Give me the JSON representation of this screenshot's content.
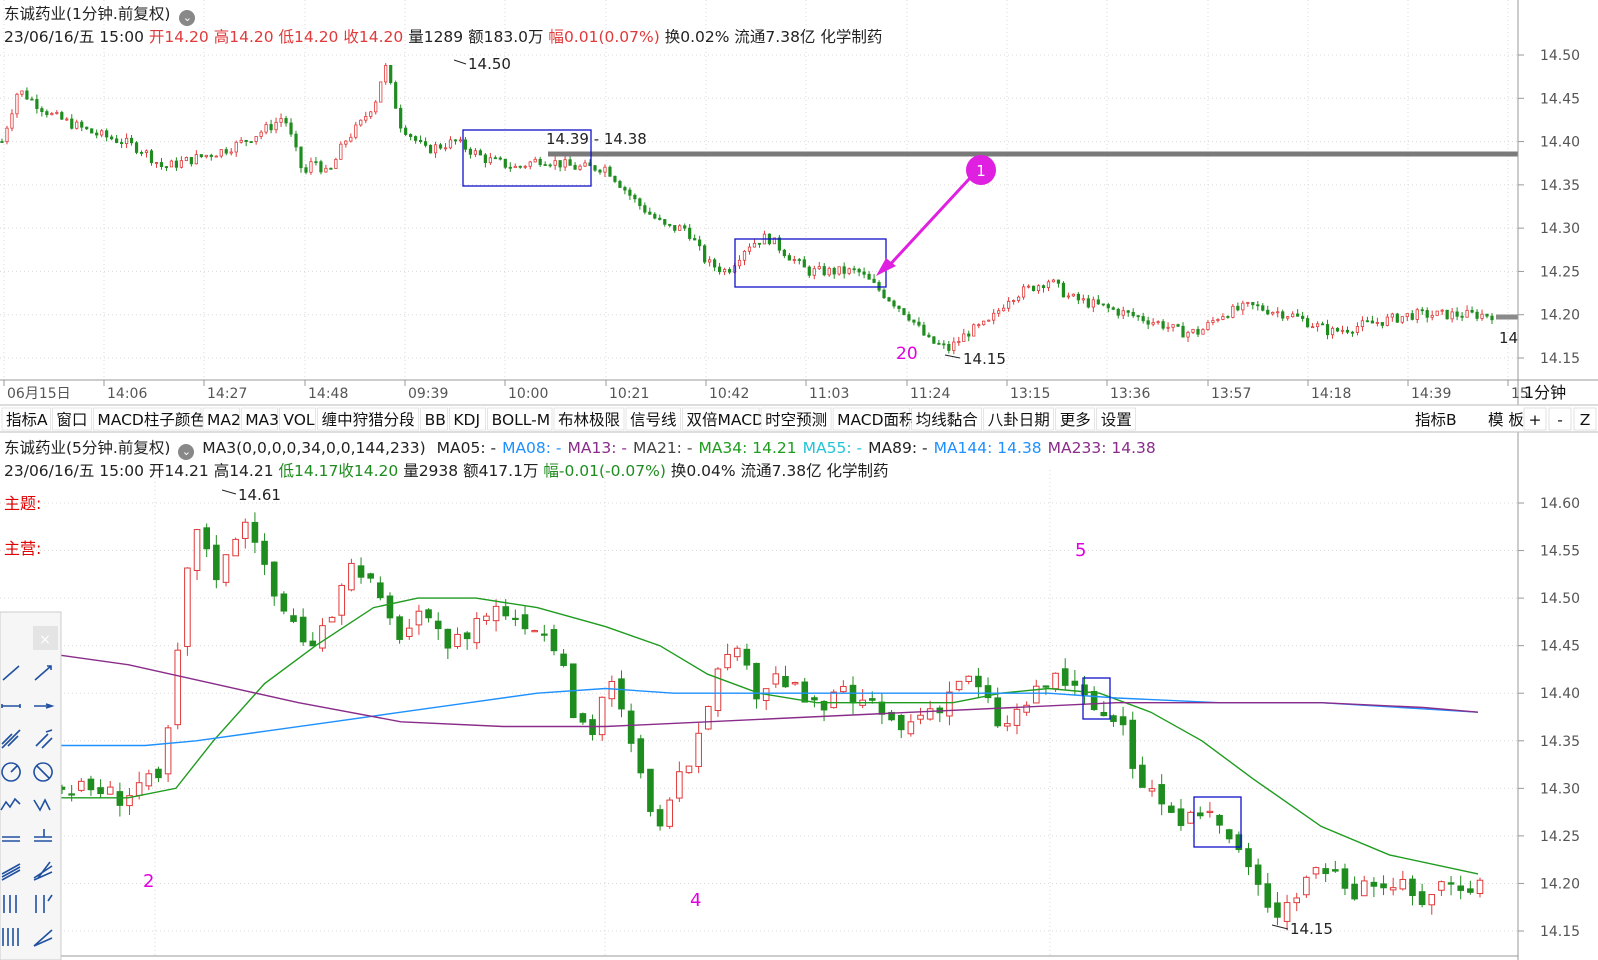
{
  "colors": {
    "up": "#e03a3a",
    "down": "#1f8c1f",
    "grid": "#d9d9d9",
    "ma34": "#1f9c1f",
    "ma144": "#1e90ff",
    "ma233": "#8a2c8a",
    "label": "#e000e0",
    "box": "#1010c8",
    "hline": "#7a7a7a"
  },
  "top": {
    "title": "东诚药业(1分钟.前复权)",
    "info": {
      "datetime": "23/06/16/五 15:00",
      "open_lbl": "开",
      "open": "14.20",
      "high_lbl": "高",
      "high": "14.20",
      "low_lbl": "低",
      "low": "14.20",
      "close_lbl": "收",
      "close": "14.20",
      "vol_lbl": "量",
      "vol": "1289",
      "amt_lbl": "额",
      "amt": "183.0万",
      "chg_lbl": "幅",
      "chg": "0.01(0.07%)",
      "turn": "换0.02%",
      "float": "流通7.38亿",
      "sector": "化学制药"
    },
    "period_btn": "1分钟",
    "annotations": {
      "high_label": "14.50",
      "low_label": "14.15",
      "range_label": "14.39 - 14.38",
      "count_label": "20",
      "marker": "1",
      "right_edge": "14"
    }
  },
  "toolbar": {
    "items": [
      "指标A",
      "窗口",
      "MACD柱子颜色",
      "MA2",
      "MA3",
      "VOL",
      "缠中狩猎分段",
      "BB",
      "KDJ",
      "BOLL-M",
      "布林极限",
      "信号线",
      "双倍MACD",
      "时空预测",
      "MACD面积",
      "均线黏合",
      "八卦日期",
      "更多",
      "设置"
    ],
    "right_items": [
      "指标B",
      "模 板"
    ],
    "icons": [
      "+",
      "-",
      "Z"
    ]
  },
  "bottom": {
    "title": "东诚药业(5分钟.前复权)",
    "ma_params": "MA3(0,0,0,0,34,0,0,144,233)",
    "ma_legend": [
      {
        "name": "MA05",
        "value": "-",
        "color": "#222222"
      },
      {
        "name": "MA08",
        "value": "-",
        "color": "#1e90ff"
      },
      {
        "name": "MA13",
        "value": "-",
        "color": "#8a2c8a"
      },
      {
        "name": "MA21",
        "value": "-",
        "color": "#444444"
      },
      {
        "name": "MA34",
        "value": "14.21",
        "color": "#1f9c1f"
      },
      {
        "name": "MA55",
        "value": "-",
        "color": "#22c4d8"
      },
      {
        "name": "MA89",
        "value": "-",
        "color": "#222222"
      },
      {
        "name": "MA144",
        "value": "14.38",
        "color": "#1e90ff"
      },
      {
        "name": "MA233",
        "value": "14.38",
        "color": "#8a2c8a"
      }
    ],
    "info": {
      "datetime": "23/06/16/五 15:00",
      "open": "开14.21",
      "high": "高14.21",
      "low": "低14.17",
      "close": "收14.20",
      "vol": "量2938",
      "amt": "额417.1万",
      "chg": "幅-0.01(-0.07%)",
      "turn": "换0.04%",
      "float": "流通7.38亿",
      "sector": "化学制药"
    },
    "side_labels": [
      "主题:",
      "主营:"
    ],
    "annotations": {
      "high_label": "14.61",
      "low_label": "14.15",
      "wave_labels": [
        "2",
        "4",
        "5"
      ]
    },
    "drawing_tools": [
      "line-tool-icon",
      "ray-tool-icon",
      "segment-tool-icon",
      "extend-line-icon",
      "parallel-icon",
      "parallel-ray-icon",
      "circle-icon",
      "circle-cross-icon",
      "wave-icon",
      "zigzag-icon",
      "gann-icon",
      "gann-fan-icon",
      "channel-icon",
      "channel-up-icon",
      "fib-lines-icon",
      "fib-time-icon",
      "bars-icon",
      "fan-icon"
    ]
  },
  "chart_data": [
    {
      "type": "candlestick",
      "title": "东诚药业(1分钟.前复权)",
      "yticks": [
        "14.50",
        "14.45",
        "14.40",
        "14.35",
        "14.30",
        "14.25",
        "14.20",
        "14.15"
      ],
      "ylim": [
        14.13,
        14.52
      ],
      "xticks": [
        "06月15日",
        "14:06",
        "14:27",
        "14:48",
        "09:39",
        "10:00",
        "10:21",
        "10:42",
        "11:03",
        "11:24",
        "13:15",
        "13:36",
        "13:57",
        "14:18",
        "14:39",
        "15"
      ],
      "bar_count": 300,
      "path": [
        [
          0,
          14.4
        ],
        [
          8,
          14.46
        ],
        [
          25,
          14.43
        ],
        [
          45,
          14.41
        ],
        [
          60,
          14.4
        ],
        [
          70,
          14.39
        ],
        [
          80,
          14.37
        ],
        [
          95,
          14.38
        ],
        [
          110,
          14.39
        ],
        [
          120,
          14.4
        ],
        [
          135,
          14.42
        ],
        [
          140,
          14.43
        ],
        [
          150,
          14.36
        ],
        [
          155,
          14.38
        ],
        [
          162,
          14.36
        ],
        [
          170,
          14.4
        ],
        [
          178,
          14.42
        ],
        [
          186,
          14.45
        ],
        [
          190,
          14.49
        ],
        [
          198,
          14.42
        ],
        [
          210,
          14.39
        ],
        [
          225,
          14.4
        ],
        [
          240,
          14.38
        ],
        [
          255,
          14.37
        ],
        [
          268,
          14.38
        ],
        [
          285,
          14.37
        ],
        [
          300,
          14.37
        ],
        [
          315,
          14.33
        ],
        [
          330,
          14.3
        ],
        [
          340,
          14.3
        ],
        [
          350,
          14.26
        ],
        [
          360,
          14.25
        ],
        [
          370,
          14.28
        ],
        [
          380,
          14.29
        ],
        [
          390,
          14.27
        ],
        [
          400,
          14.25
        ],
        [
          415,
          14.25
        ],
        [
          425,
          14.25
        ],
        [
          440,
          14.22
        ],
        [
          450,
          14.2
        ],
        [
          460,
          14.17
        ],
        [
          470,
          14.16
        ],
        [
          480,
          14.18
        ],
        [
          490,
          14.19
        ],
        [
          500,
          14.22
        ],
        [
          510,
          14.23
        ],
        [
          520,
          14.24
        ],
        [
          530,
          14.22
        ],
        [
          545,
          14.21
        ],
        [
          560,
          14.2
        ],
        [
          575,
          14.19
        ],
        [
          585,
          14.18
        ],
        [
          595,
          14.18
        ],
        [
          605,
          14.2
        ],
        [
          620,
          14.21
        ],
        [
          640,
          14.2
        ],
        [
          660,
          14.18
        ],
        [
          680,
          14.19
        ],
        [
          700,
          14.2
        ],
        [
          720,
          14.2
        ],
        [
          740,
          14.2
        ]
      ],
      "high": 14.5,
      "low": 14.15,
      "hline": {
        "value": 14.385,
        "label": "14.39 - 14.38"
      },
      "boxes": [
        {
          "x_from": 185,
          "x_to": 230,
          "y_from": 14.35,
          "y_to": 14.415
        },
        {
          "x_from": 340,
          "x_to": 425,
          "y_from": 14.23,
          "y_to": 14.29
        }
      ]
    },
    {
      "type": "candlestick",
      "title": "东诚药业(5分钟.前复权)",
      "yticks": [
        "14.60",
        "14.55",
        "14.50",
        "14.45",
        "14.40",
        "14.35",
        "14.30",
        "14.25",
        "14.20",
        "14.15"
      ],
      "ylim": [
        14.135,
        14.615
      ],
      "bar_count": 148,
      "path": [
        [
          0,
          14.3
        ],
        [
          10,
          14.3
        ],
        [
          18,
          14.29
        ],
        [
          24,
          14.31
        ],
        [
          28,
          14.3
        ],
        [
          30,
          14.33
        ],
        [
          34,
          14.44
        ],
        [
          38,
          14.57
        ],
        [
          42,
          14.56
        ],
        [
          46,
          14.52
        ],
        [
          52,
          14.58
        ],
        [
          55,
          14.59
        ],
        [
          60,
          14.52
        ],
        [
          64,
          14.49
        ],
        [
          68,
          14.48
        ],
        [
          72,
          14.44
        ],
        [
          78,
          14.47
        ],
        [
          82,
          14.52
        ],
        [
          86,
          14.54
        ],
        [
          90,
          14.52
        ],
        [
          95,
          14.48
        ],
        [
          100,
          14.46
        ],
        [
          104,
          14.48
        ],
        [
          108,
          14.47
        ],
        [
          112,
          14.45
        ],
        [
          118,
          14.46
        ],
        [
          122,
          14.48
        ],
        [
          128,
          14.49
        ],
        [
          134,
          14.48
        ],
        [
          140,
          14.47
        ],
        [
          145,
          14.45
        ],
        [
          150,
          14.38
        ],
        [
          156,
          14.36
        ],
        [
          160,
          14.42
        ],
        [
          164,
          14.38
        ],
        [
          168,
          14.33
        ],
        [
          172,
          14.29
        ],
        [
          176,
          14.25
        ],
        [
          180,
          14.3
        ],
        [
          184,
          14.33
        ],
        [
          188,
          14.38
        ],
        [
          192,
          14.42
        ],
        [
          198,
          14.44
        ],
        [
          204,
          14.4
        ],
        [
          210,
          14.42
        ],
        [
          216,
          14.4
        ],
        [
          222,
          14.38
        ],
        [
          228,
          14.4
        ],
        [
          234,
          14.39
        ],
        [
          240,
          14.38
        ],
        [
          246,
          14.36
        ],
        [
          252,
          14.38
        ],
        [
          258,
          14.39
        ],
        [
          264,
          14.42
        ],
        [
          270,
          14.4
        ],
        [
          276,
          14.36
        ],
        [
          280,
          14.38
        ],
        [
          286,
          14.4
        ],
        [
          292,
          14.42
        ],
        [
          298,
          14.4
        ],
        [
          304,
          14.38
        ],
        [
          310,
          14.37
        ],
        [
          316,
          14.31
        ],
        [
          322,
          14.29
        ],
        [
          328,
          14.25
        ],
        [
          334,
          14.28
        ],
        [
          340,
          14.26
        ],
        [
          346,
          14.23
        ],
        [
          350,
          14.2
        ],
        [
          356,
          14.17
        ],
        [
          362,
          14.19
        ],
        [
          368,
          14.22
        ],
        [
          374,
          14.21
        ],
        [
          380,
          14.19
        ],
        [
          386,
          14.2
        ],
        [
          392,
          14.2
        ],
        [
          398,
          14.18
        ],
        [
          404,
          14.2
        ],
        [
          410,
          14.2
        ],
        [
          416,
          14.2
        ]
      ],
      "high": 14.61,
      "low": 14.15,
      "ma34": [
        [
          0,
          14.29
        ],
        [
          20,
          14.29
        ],
        [
          34,
          14.3
        ],
        [
          45,
          14.35
        ],
        [
          60,
          14.41
        ],
        [
          75,
          14.45
        ],
        [
          92,
          14.49
        ],
        [
          105,
          14.5
        ],
        [
          122,
          14.5
        ],
        [
          140,
          14.49
        ],
        [
          160,
          14.47
        ],
        [
          176,
          14.45
        ],
        [
          190,
          14.42
        ],
        [
          205,
          14.4
        ],
        [
          222,
          14.39
        ],
        [
          245,
          14.39
        ],
        [
          262,
          14.39
        ],
        [
          276,
          14.4
        ],
        [
          290,
          14.405
        ],
        [
          305,
          14.4
        ],
        [
          320,
          14.38
        ],
        [
          335,
          14.35
        ],
        [
          350,
          14.31
        ],
        [
          370,
          14.26
        ],
        [
          390,
          14.23
        ],
        [
          416,
          14.21
        ]
      ],
      "ma144": [
        [
          0,
          14.345
        ],
        [
          25,
          14.345
        ],
        [
          40,
          14.35
        ],
        [
          60,
          14.36
        ],
        [
          80,
          14.37
        ],
        [
          100,
          14.38
        ],
        [
          120,
          14.39
        ],
        [
          140,
          14.4
        ],
        [
          160,
          14.405
        ],
        [
          180,
          14.4
        ],
        [
          200,
          14.4
        ],
        [
          230,
          14.4
        ],
        [
          260,
          14.4
        ],
        [
          290,
          14.4
        ],
        [
          310,
          14.395
        ],
        [
          340,
          14.39
        ],
        [
          370,
          14.39
        ],
        [
          416,
          14.38
        ]
      ],
      "ma233": [
        [
          0,
          14.44
        ],
        [
          20,
          14.43
        ],
        [
          45,
          14.41
        ],
        [
          70,
          14.39
        ],
        [
          100,
          14.37
        ],
        [
          130,
          14.365
        ],
        [
          160,
          14.365
        ],
        [
          190,
          14.37
        ],
        [
          220,
          14.375
        ],
        [
          250,
          14.38
        ],
        [
          280,
          14.385
        ],
        [
          310,
          14.39
        ],
        [
          340,
          14.39
        ],
        [
          370,
          14.39
        ],
        [
          400,
          14.385
        ],
        [
          416,
          14.38
        ]
      ],
      "boxes": [
        {
          "x_from": 307,
          "x_to": 316,
          "y_from": 14.37,
          "y_to": 14.41
        },
        {
          "x_from": 334,
          "x_to": 348,
          "y_from": 14.235,
          "y_to": 14.29
        }
      ]
    }
  ]
}
